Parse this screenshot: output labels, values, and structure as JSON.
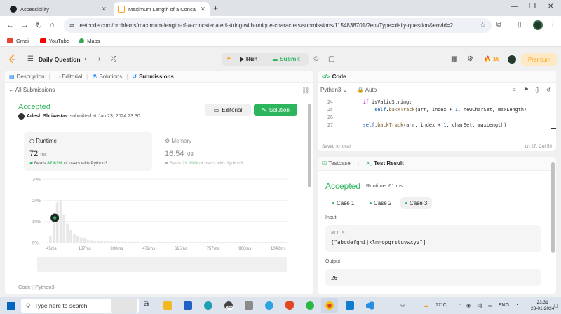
{
  "browser": {
    "tabs": [
      {
        "title": "Accessibility",
        "active": false
      },
      {
        "title": "Maximum Length of a Concate",
        "active": true
      }
    ],
    "url": "leetcode.com/problems/maximum-length-of-a-concatenated-string-with-unique-characters/submissions/1154838701/?envType=daily-question&envId=2...",
    "bookmarks": [
      "Gmail",
      "YouTube",
      "Maps"
    ]
  },
  "header": {
    "title": "Daily Question",
    "run": "Run",
    "submit": "Submit",
    "streak": "16",
    "premium": "Premium"
  },
  "left": {
    "tabs": [
      "Description",
      "Editorial",
      "Solutions",
      "Submissions"
    ],
    "back_link": "All Submissions",
    "status": "Accepted",
    "author": "Adesh Shrivastav",
    "submitted": "submitted at Jan 23, 2024 23:30",
    "editorial_btn": "Editorial",
    "solution_btn": "Solution",
    "runtime": {
      "label": "Runtime",
      "value": "72",
      "unit": "ms",
      "beats_prefix": "Beats",
      "beats_pct": "87.63%",
      "beats_suffix": "of users with Python3"
    },
    "memory": {
      "label": "Memory",
      "value": "16.54",
      "unit": "MB",
      "beats_prefix": "Beats",
      "beats_pct": "79.19%",
      "beats_suffix": "of users with Python3"
    },
    "code_tab": "Code",
    "code_lang": "Python3"
  },
  "chart_data": {
    "type": "bar",
    "y_ticks": [
      "30%",
      "20%",
      "10%",
      "0%"
    ],
    "x_ticks": [
      "45ms",
      "187ms",
      "330ms",
      "472ms",
      "615ms",
      "757ms",
      "900ms",
      "1042ms"
    ],
    "ylim": [
      0,
      30
    ],
    "values": [
      3,
      14,
      19,
      20,
      13,
      9,
      6,
      4,
      3,
      2.5,
      2,
      1.5,
      1.2,
      1,
      1,
      0.8,
      0.7,
      0.6,
      0.6,
      0.5,
      0.5,
      0.5,
      0.4,
      0.4,
      0.4,
      0.4,
      0.3,
      0.3,
      0.3,
      0.3,
      0.3,
      0.3,
      0.3,
      0.3,
      0.3,
      0.3,
      0.3,
      0.3,
      0.3,
      0.3,
      0.3,
      0.3,
      0.3,
      0.3,
      0.3,
      0.3,
      0.3,
      0.3,
      0.3,
      0.3,
      0.3,
      0.3,
      0.3,
      0.3,
      0.3,
      0.3,
      0.3,
      0.3,
      0.3,
      0.3,
      0.3,
      0.3,
      0.3,
      0.3,
      0.3,
      0.3,
      0.3,
      0.3,
      0.3,
      0.3
    ],
    "highlight_index": 2,
    "grid": true
  },
  "code": {
    "title": "Code",
    "lang": "Python3",
    "mode": "Auto",
    "lines": [
      {
        "n": "24",
        "indent": "        ",
        "parts": [
          [
            "kw",
            "if "
          ],
          [
            "",
            "isValidString:"
          ]
        ]
      },
      {
        "n": "25",
        "indent": "            ",
        "parts": [
          [
            "sf",
            "self"
          ],
          [
            "",
            "."
          ],
          [
            "fn",
            "backTrack"
          ],
          [
            "",
            "(arr, index + "
          ],
          [
            "sf",
            "1"
          ],
          [
            "",
            ", newCharSet, maxLength)"
          ]
        ]
      },
      {
        "n": "26",
        "indent": "",
        "parts": []
      },
      {
        "n": "27",
        "indent": "        ",
        "parts": [
          [
            "sf",
            "self"
          ],
          [
            "",
            "."
          ],
          [
            "fn",
            "backTrack"
          ],
          [
            "",
            "(arr, index + "
          ],
          [
            "sf",
            "1"
          ],
          [
            "",
            ", charSet, maxLength)"
          ]
        ]
      }
    ],
    "saved": "Saved to local",
    "cursor": "Ln 27, Col 59"
  },
  "test": {
    "tabs": [
      "Testcase",
      "Test Result"
    ],
    "status": "Accepted",
    "runtime": "Runtime: 61 ms",
    "cases": [
      "Case 1",
      "Case 2",
      "Case 3"
    ],
    "input_label": "Input",
    "var_name": "arr =",
    "input_value": "[\"abcdefghijklmnopqrstuvwxyz\"]",
    "output_label": "Output",
    "output_value": "26"
  },
  "taskbar": {
    "search_placeholder": "Type here to search",
    "temp": "17°C",
    "lang": "ENG",
    "time": "23:31",
    "date": "23-01-2024",
    "badge": "99+"
  }
}
